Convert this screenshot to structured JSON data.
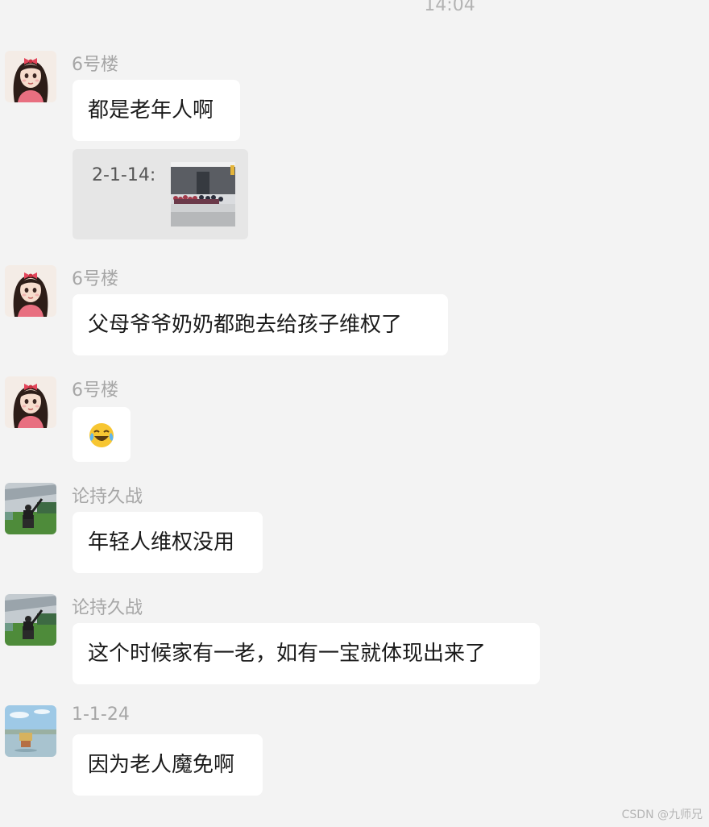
{
  "chat": {
    "timestamp": "14:04",
    "messages": [
      {
        "sender": "6号楼",
        "avatar": "girl-avatar",
        "text": "都是老年人啊"
      },
      {
        "quote": {
          "label": "2-1-14:",
          "image": "street-crowd-photo"
        }
      },
      {
        "sender": "6号楼",
        "avatar": "girl-avatar",
        "text": "父母爷爷奶奶都跑去给孩子维权了"
      },
      {
        "sender": "6号楼",
        "avatar": "girl-avatar",
        "emoji": "crying-laughing-emoji"
      },
      {
        "sender": "论持久战",
        "avatar": "man-on-grass-avatar",
        "text": "年轻人维权没用"
      },
      {
        "sender": "论持久战",
        "avatar": "man-on-grass-avatar",
        "text": "这个时候家有一老，如有一宝就体现出来了"
      },
      {
        "sender": "1-1-24",
        "avatar": "seaside-avatar",
        "text": "因为老人魔免啊"
      }
    ]
  },
  "watermark": "CSDN @九师兄",
  "colors": {
    "background": "#f3f3f3",
    "bubble": "#ffffff",
    "quote_background": "#e6e6e6",
    "sender_text": "#a6a6a6"
  }
}
